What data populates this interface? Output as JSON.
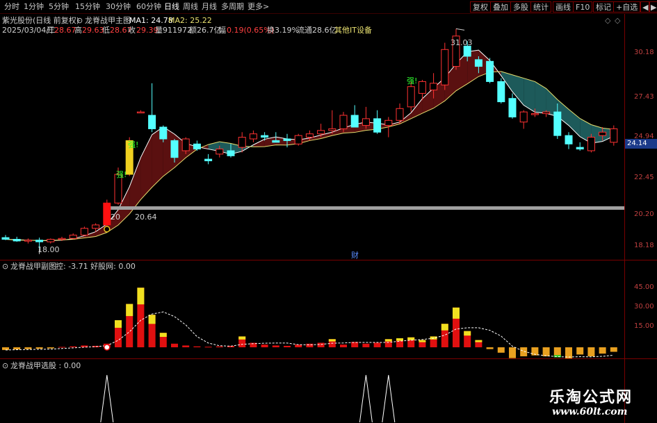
{
  "toolbar": {
    "periods": [
      "分时",
      "1分钟",
      "5分钟",
      "15分钟",
      "30分钟",
      "60分钟",
      "日线",
      "周线",
      "月线",
      "多周期",
      "更多>"
    ],
    "active_period": "日线",
    "buttons": [
      "复权",
      "叠加",
      "多股",
      "统计",
      "画线",
      "F10",
      "标记",
      "+自选",
      "◀",
      "▶"
    ]
  },
  "header": {
    "stock_title": "紫光股份(日线 前复权)",
    "indicator_name": "龙脊战甲主图",
    "ma1_label": "MA1: 24.78",
    "ma2_label": "MA2: 25.22",
    "date": "2025/03/04/二",
    "open_label": "开",
    "open_value": "28.67",
    "high_label": "高",
    "high_value": "29.63",
    "low_label": "低",
    "low_value": "28.67",
    "close_label": "收",
    "close_value": "29.39",
    "volume": "量911972",
    "amount": "额26.7亿",
    "change_label": "幅",
    "change_value": "0.19(0.65%)",
    "turnover": "换3.19%",
    "float_cap": "流通28.6亿",
    "sector": "其他IT设备",
    "corner_icons": [
      "◇",
      "◇"
    ]
  },
  "price_axis": [
    "30.18",
    "27.43",
    "24.94",
    "22.45",
    "20.20",
    "18.18"
  ],
  "current_price": "24.14",
  "annotations": {
    "high_price": "31.03",
    "low_price": "18.00",
    "support_left": "20",
    "support_right": "20.64",
    "strong_marks": [
      "强!",
      "强!",
      "强!"
    ],
    "fin_mark": "财"
  },
  "sub_panel": {
    "title": "龙脊战甲副图",
    "values": "控: -3.71  好股网: 0.00",
    "axis": [
      "45.00",
      "30.00",
      "15.00"
    ]
  },
  "pick_panel": {
    "title": "龙脊战甲选股 : 0.00"
  },
  "watermark": {
    "title": "乐淘公式网",
    "url": "www.60lt.com"
  },
  "colors": {
    "up": "#ff3232",
    "down": "#54ffff",
    "ribbon_up": "#5a1010",
    "ribbon_down": "#1d5a5a",
    "ma_line": "#e8e070",
    "volume_bar": "#e01010",
    "volume_top": "#f0e020",
    "neg_bar": "#e8a020"
  },
  "chart_data": {
    "type": "candlestick",
    "y_range": [
      17.5,
      31.5
    ],
    "candles": [
      {
        "o": 18.65,
        "h": 18.8,
        "l": 18.5,
        "c": 18.55
      },
      {
        "o": 18.55,
        "h": 18.7,
        "l": 18.4,
        "c": 18.45
      },
      {
        "o": 18.45,
        "h": 18.6,
        "l": 18.3,
        "c": 18.5
      },
      {
        "o": 18.5,
        "h": 18.65,
        "l": 18.0,
        "c": 18.4
      },
      {
        "o": 18.4,
        "h": 18.6,
        "l": 18.3,
        "c": 18.55
      },
      {
        "o": 18.55,
        "h": 18.7,
        "l": 18.45,
        "c": 18.6
      },
      {
        "o": 18.6,
        "h": 18.9,
        "l": 18.55,
        "c": 18.8
      },
      {
        "o": 18.8,
        "h": 19.3,
        "l": 18.75,
        "c": 19.2
      },
      {
        "o": 19.2,
        "h": 19.5,
        "l": 19.0,
        "c": 19.4
      },
      {
        "o": 19.4,
        "h": 20.9,
        "l": 19.2,
        "c": 20.7
      },
      {
        "o": 20.7,
        "h": 22.8,
        "l": 20.6,
        "c": 22.4
      },
      {
        "o": 22.4,
        "h": 24.6,
        "l": 22.3,
        "c": 24.4
      },
      {
        "o": 26.1,
        "h": 26.2,
        "l": 26.1,
        "c": 26.1
      },
      {
        "o": 25.9,
        "h": 27.8,
        "l": 24.9,
        "c": 25.1
      },
      {
        "o": 25.2,
        "h": 25.3,
        "l": 24.3,
        "c": 24.5
      },
      {
        "o": 24.4,
        "h": 24.5,
        "l": 23.1,
        "c": 23.4
      },
      {
        "o": 23.8,
        "h": 24.6,
        "l": 23.6,
        "c": 24.5
      },
      {
        "o": 24.2,
        "h": 24.4,
        "l": 23.8,
        "c": 23.9
      },
      {
        "o": 23.3,
        "h": 23.6,
        "l": 23.0,
        "c": 23.2
      },
      {
        "o": 23.6,
        "h": 24.1,
        "l": 23.4,
        "c": 23.9
      },
      {
        "o": 23.8,
        "h": 24.2,
        "l": 23.4,
        "c": 23.5
      },
      {
        "o": 24.0,
        "h": 24.9,
        "l": 23.7,
        "c": 24.6
      },
      {
        "o": 24.5,
        "h": 25.0,
        "l": 24.3,
        "c": 24.8
      },
      {
        "o": 24.7,
        "h": 24.9,
        "l": 24.4,
        "c": 24.6
      },
      {
        "o": 24.4,
        "h": 24.9,
        "l": 24.3,
        "c": 24.3
      },
      {
        "o": 24.5,
        "h": 24.8,
        "l": 24.0,
        "c": 24.4
      },
      {
        "o": 24.2,
        "h": 24.8,
        "l": 24.1,
        "c": 24.7
      },
      {
        "o": 24.6,
        "h": 25.0,
        "l": 24.4,
        "c": 24.8
      },
      {
        "o": 24.8,
        "h": 25.4,
        "l": 24.6,
        "c": 25.0
      },
      {
        "o": 25.0,
        "h": 26.2,
        "l": 24.8,
        "c": 25.1
      },
      {
        "o": 25.1,
        "h": 26.1,
        "l": 24.9,
        "c": 25.9
      },
      {
        "o": 25.9,
        "h": 26.5,
        "l": 25.2,
        "c": 25.2
      },
      {
        "o": 25.3,
        "h": 26.4,
        "l": 25.1,
        "c": 25.7
      },
      {
        "o": 25.7,
        "h": 26.2,
        "l": 24.8,
        "c": 24.9
      },
      {
        "o": 25.3,
        "h": 25.8,
        "l": 24.6,
        "c": 25.6
      },
      {
        "o": 25.6,
        "h": 26.6,
        "l": 25.4,
        "c": 26.3
      },
      {
        "o": 26.4,
        "h": 27.9,
        "l": 26.1,
        "c": 27.6
      },
      {
        "o": 27.2,
        "h": 28.0,
        "l": 26.8,
        "c": 27.9
      },
      {
        "o": 27.4,
        "h": 28.4,
        "l": 26.9,
        "c": 27.8
      },
      {
        "o": 27.7,
        "h": 30.2,
        "l": 27.4,
        "c": 29.8
      },
      {
        "o": 28.8,
        "h": 31.03,
        "l": 28.6,
        "c": 30.6
      },
      {
        "o": 30.0,
        "h": 30.3,
        "l": 29.1,
        "c": 29.4
      },
      {
        "o": 29.2,
        "h": 29.4,
        "l": 28.4,
        "c": 28.8
      },
      {
        "o": 29.1,
        "h": 29.3,
        "l": 27.8,
        "c": 27.9
      },
      {
        "o": 27.9,
        "h": 28.1,
        "l": 26.6,
        "c": 26.7
      },
      {
        "o": 26.9,
        "h": 27.2,
        "l": 25.7,
        "c": 25.8
      },
      {
        "o": 25.5,
        "h": 26.2,
        "l": 25.1,
        "c": 26.1
      },
      {
        "o": 26.0,
        "h": 26.3,
        "l": 25.8,
        "c": 26.0
      },
      {
        "o": 26.0,
        "h": 26.2,
        "l": 25.8,
        "c": 26.1
      },
      {
        "o": 26.1,
        "h": 26.6,
        "l": 24.5,
        "c": 24.7
      },
      {
        "o": 24.7,
        "h": 24.9,
        "l": 23.9,
        "c": 24.2
      },
      {
        "o": 24.0,
        "h": 24.3,
        "l": 23.8,
        "c": 23.9
      },
      {
        "o": 23.8,
        "h": 24.8,
        "l": 23.7,
        "c": 24.6
      },
      {
        "o": 24.7,
        "h": 25.2,
        "l": 24.4,
        "c": 24.9
      },
      {
        "o": 24.3,
        "h": 25.3,
        "l": 24.1,
        "c": 25.1
      }
    ],
    "sub_values": [
      -1.5,
      -1.2,
      -1.0,
      -0.8,
      -0.6,
      0.2,
      0.5,
      1.0,
      0.8,
      2.0,
      15.0,
      24.0,
      33.0,
      18.0,
      8.0,
      2.0,
      1.0,
      0.5,
      0.3,
      0.5,
      0.8,
      6.0,
      2.5,
      1.5,
      1.0,
      0.8,
      1.5,
      2.0,
      2.5,
      4.5,
      1.5,
      3.0,
      2.0,
      2.5,
      4.5,
      5.0,
      5.5,
      4.0,
      6.0,
      13.0,
      22.0,
      9.0,
      4.0,
      -1.0,
      -3.0,
      -6.0,
      -5.0,
      -4.5,
      -5.0,
      -5.5,
      -7.0,
      -4.0,
      -5.0,
      -3.5,
      -2.5
    ],
    "pick_signals": [
      9,
      32,
      34
    ]
  }
}
